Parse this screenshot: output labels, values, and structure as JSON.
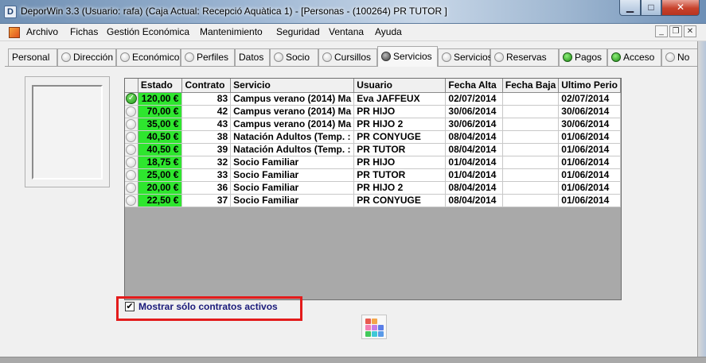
{
  "window": {
    "app_icon_letter": "D",
    "title": "DeporWin 3.3  (Usuario: rafa)  (Caja Actual: Recepció Aquàtica 1) - [Personas - (100264) PR TUTOR  ]",
    "min_glyph": "▁",
    "max_glyph": "□",
    "close_glyph": "✕"
  },
  "menubar": {
    "items": [
      "Archivo",
      "Fichas",
      "Gestión Económica",
      "Mantenimiento",
      "Seguridad",
      "Ventana",
      "Ayuda"
    ],
    "mdi": [
      "_",
      "❐",
      "✕"
    ]
  },
  "tabs": [
    {
      "label": "Personal",
      "radio": "none"
    },
    {
      "label": "Dirección",
      "radio": "empty"
    },
    {
      "label": "Económico",
      "radio": "empty"
    },
    {
      "label": "Perfiles",
      "radio": "empty"
    },
    {
      "label": "Datos",
      "radio": "none"
    },
    {
      "label": "Socio",
      "radio": "empty"
    },
    {
      "label": "Cursillos",
      "radio": "empty"
    },
    {
      "label": "Servicios",
      "radio": "dark",
      "active": true
    },
    {
      "label": "Servicios",
      "radio": "empty"
    },
    {
      "label": "Reservas",
      "radio": "empty"
    },
    {
      "label": "Pagos",
      "radio": "green"
    },
    {
      "label": "Acceso",
      "radio": "green"
    },
    {
      "label": "No",
      "radio": "empty"
    }
  ],
  "grid": {
    "columns": [
      "Estado",
      "Contrato",
      "Servicio",
      "Usuario",
      "Fecha Alta",
      "Fecha Baja",
      "Ultimo Perio"
    ],
    "rows": [
      {
        "indicator": "check",
        "estado": "120,00 €",
        "contrato": "83",
        "servicio": "Campus verano (2014) Ma",
        "usuario": "Eva  JAFFEUX",
        "fecha_alta": "02/07/2014",
        "fecha_baja": "",
        "ultimo": "02/07/2014"
      },
      {
        "indicator": "radio",
        "estado": "70,00 €",
        "contrato": "42",
        "servicio": "Campus verano (2014) Ma",
        "usuario": "PR HIJO",
        "fecha_alta": "30/06/2014",
        "fecha_baja": "",
        "ultimo": "30/06/2014"
      },
      {
        "indicator": "radio",
        "estado": "35,00 €",
        "contrato": "43",
        "servicio": "Campus verano (2014) Ma",
        "usuario": "PR HIJO 2",
        "fecha_alta": "30/06/2014",
        "fecha_baja": "",
        "ultimo": "30/06/2014"
      },
      {
        "indicator": "radio",
        "estado": "40,50 €",
        "contrato": "38",
        "servicio": "Natación Adultos (Temp. :",
        "usuario": "PR CONYUGE",
        "fecha_alta": "08/04/2014",
        "fecha_baja": "",
        "ultimo": "01/06/2014"
      },
      {
        "indicator": "radio",
        "estado": "40,50 €",
        "contrato": "39",
        "servicio": "Natación Adultos (Temp. :",
        "usuario": "PR TUTOR",
        "fecha_alta": "08/04/2014",
        "fecha_baja": "",
        "ultimo": "01/06/2014"
      },
      {
        "indicator": "radio",
        "estado": "18,75 €",
        "contrato": "32",
        "servicio": "Socio Familiar",
        "usuario": "PR HIJO",
        "fecha_alta": "01/04/2014",
        "fecha_baja": "",
        "ultimo": "01/06/2014"
      },
      {
        "indicator": "radio",
        "estado": "25,00 €",
        "contrato": "33",
        "servicio": "Socio Familiar",
        "usuario": "PR TUTOR",
        "fecha_alta": "01/04/2014",
        "fecha_baja": "",
        "ultimo": "01/06/2014"
      },
      {
        "indicator": "radio",
        "estado": "20,00 €",
        "contrato": "36",
        "servicio": "Socio Familiar",
        "usuario": "PR HIJO 2",
        "fecha_alta": "08/04/2014",
        "fecha_baja": "",
        "ultimo": "01/06/2014"
      },
      {
        "indicator": "radio",
        "estado": "22,50 €",
        "contrato": "37",
        "servicio": "Socio Familiar",
        "usuario": "PR CONYUGE",
        "fecha_alta": "08/04/2014",
        "fecha_baja": "",
        "ultimo": "01/06/2014"
      }
    ]
  },
  "filter": {
    "checkbox_mark": "✔",
    "checked": true,
    "label": "Mostrar sólo contratos activos"
  },
  "colors": {
    "estado_active": "#2ee62e",
    "highlight": "#e31b1b",
    "label_text": "#1a1a7a"
  }
}
